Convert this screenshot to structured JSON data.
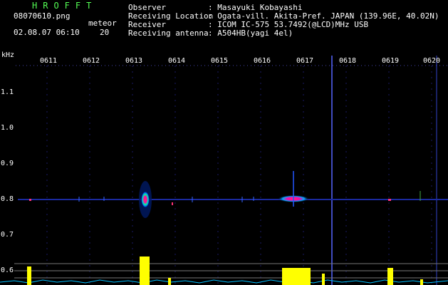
{
  "header": {
    "app_name": "HROFFT",
    "filename": "08070610.png",
    "datetime": "02.08.07 06:10",
    "meteor_label": "meteor",
    "meteor_count": "20"
  },
  "info": {
    "observer_key": "Observer",
    "observer_val": ": Masayuki Kobayashi",
    "location_key": "Receiving Location",
    "location_val": ": Ogata-vill. Akita-Pref. JAPAN (139.96E, 40.02N)",
    "receiver_key": "Receiver",
    "receiver_val": ": ICOM IC-575 53.7492(@LCD)MHz USB",
    "antenna_key": "Receiving antenna",
    "antenna_val": ": A504HB(yagi 4el)"
  },
  "axes": {
    "unit": "kHz",
    "y_ticks": [
      "1.1",
      "1.0",
      "0.9",
      "0.8",
      "0.7",
      "0.6"
    ],
    "x_ticks": [
      "0611",
      "0612",
      "0613",
      "0614",
      "0615",
      "0616",
      "0617",
      "0618",
      "0619",
      "0620"
    ]
  },
  "colors": {
    "title": "#55ff55",
    "spectrum_low": "#00008b",
    "signal_hot": "#ff3366",
    "meteor_bar": "#ffff00",
    "noise": "#00bfff"
  }
}
